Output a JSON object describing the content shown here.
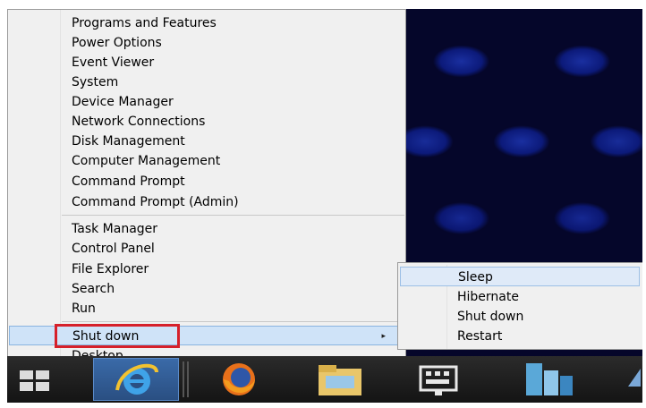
{
  "context_menu": {
    "items": [
      {
        "label": "Programs and Features"
      },
      {
        "label": "Power Options"
      },
      {
        "label": "Event Viewer"
      },
      {
        "label": "System"
      },
      {
        "label": "Device Manager"
      },
      {
        "label": "Network Connections"
      },
      {
        "label": "Disk Management"
      },
      {
        "label": "Computer Management"
      },
      {
        "label": "Command Prompt"
      },
      {
        "label": "Command Prompt (Admin)"
      },
      {
        "label": "Task Manager"
      },
      {
        "label": "Control Panel"
      },
      {
        "label": "File Explorer"
      },
      {
        "label": "Search"
      },
      {
        "label": "Run"
      },
      {
        "label": "Shut down",
        "submenu_arrow": "▸"
      },
      {
        "label": "Desktop"
      }
    ]
  },
  "shutdown_submenu": {
    "items": [
      {
        "label": "Sleep"
      },
      {
        "label": "Hibernate"
      },
      {
        "label": "Shut down"
      },
      {
        "label": "Restart"
      }
    ]
  },
  "taskbar": {
    "items": [
      "windows-start-icon",
      "internet-explorer-icon",
      "firefox-icon",
      "file-explorer-icon",
      "keyboard-icon",
      "server-manager-icon"
    ]
  },
  "colors": {
    "highlight": "#cfe3f8",
    "callout_border": "#d6202a",
    "desktop_bg": "#05062a"
  }
}
